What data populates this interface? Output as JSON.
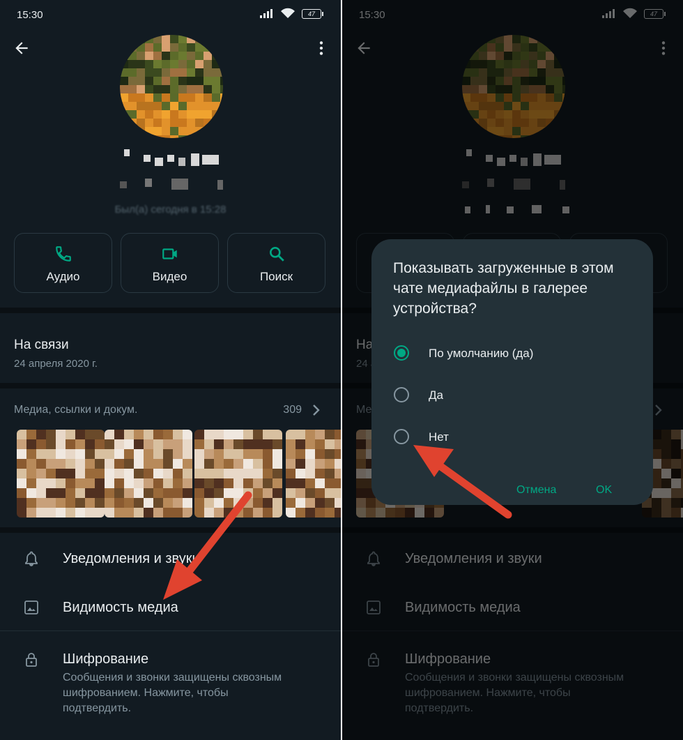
{
  "status_bar": {
    "time": "15:30",
    "battery": "47"
  },
  "profile": {
    "last_seen": "Был(а) сегодня в 15:28"
  },
  "actions": [
    {
      "label": "Аудио",
      "icon": "phone-icon"
    },
    {
      "label": "Видео",
      "icon": "video-icon"
    },
    {
      "label": "Поиск",
      "icon": "search-icon"
    }
  ],
  "about": {
    "title": "На связи",
    "date": "24 апреля 2020 г."
  },
  "media": {
    "heading": "Медиа, ссылки и докум.",
    "count": "309"
  },
  "settings": {
    "notifications": "Уведомления и звуки",
    "media_visibility": "Видимость медиа",
    "encryption_title": "Шифрование",
    "encryption_sub": "Сообщения и звонки защищены сквозным шифрованием. Нажмите, чтобы подтвердить."
  },
  "dialog": {
    "question": "Показывать загруженные в этом чате медиафайлы в галерее устройства?",
    "options": [
      "По умолчанию (да)",
      "Да",
      "Нет"
    ],
    "selected_index": 0,
    "cancel": "Отмена",
    "ok": "OK"
  },
  "colors": {
    "accent": "#00a884",
    "background": "#121b22",
    "arrow": "#e0432f"
  }
}
